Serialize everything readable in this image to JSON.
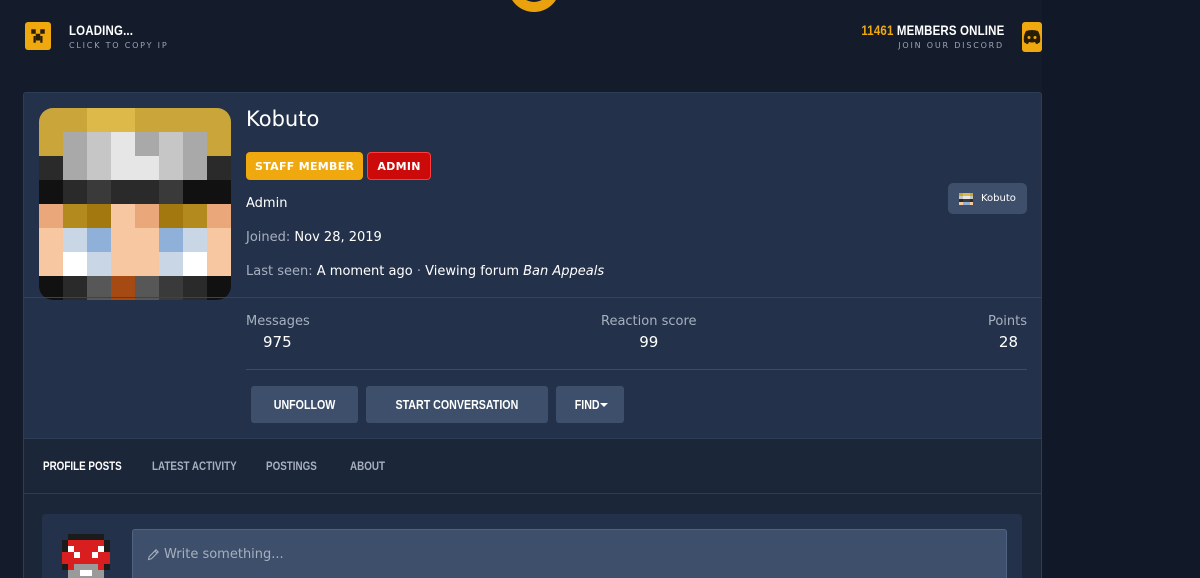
{
  "header": {
    "server_status": "LOADING...",
    "copy_ip_hint": "CLICK TO COPY IP",
    "members_count": "11461",
    "members_label": "MEMBERS ONLINE",
    "discord_hint": "JOIN OUR DISCORD"
  },
  "colors": {
    "accent": "#f0a80f",
    "admin_red": "#cc0a0a",
    "card_bg": "#23324a",
    "page_bg": "#141c2b"
  },
  "profile": {
    "username": "Kobuto",
    "badges": [
      "STAFF MEMBER",
      "ADMIN"
    ],
    "user_title": "Admin",
    "joined_label": "Joined:",
    "joined_date": "Nov 28, 2019",
    "last_seen_label": "Last seen:",
    "last_seen_value": "A moment ago",
    "activity_prefix": "Viewing forum",
    "activity_forum": "Ban Appeals",
    "chip_name": "Kobuto"
  },
  "stats": [
    {
      "label": "Messages",
      "value": "975"
    },
    {
      "label": "Reaction score",
      "value": "99"
    },
    {
      "label": "Points",
      "value": "28"
    }
  ],
  "actions": {
    "unfollow": "UNFOLLOW",
    "start_conversation": "START CONVERSATION",
    "find": "FIND"
  },
  "tabs": [
    {
      "label": "PROFILE POSTS",
      "active": true
    },
    {
      "label": "LATEST ACTIVITY",
      "active": false
    },
    {
      "label": "POSTINGS",
      "active": false
    },
    {
      "label": "ABOUT",
      "active": false
    }
  ],
  "composer": {
    "placeholder": "Write something..."
  },
  "icons": [
    "creeper-icon",
    "discord-icon",
    "pencil-icon",
    "caret-down-icon"
  ]
}
